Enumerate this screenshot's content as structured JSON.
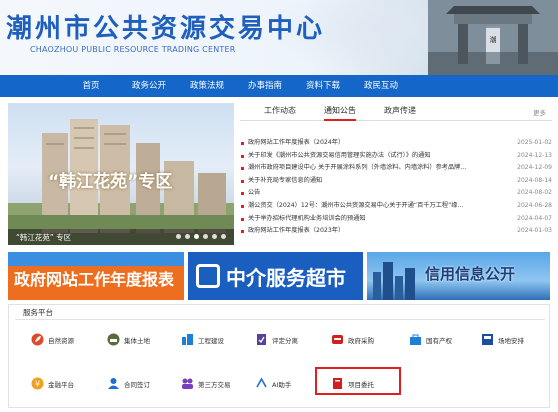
{
  "header": {
    "title": "潮州市公共资源交易中心",
    "subtitle": "CHAOZHOU PUBLIC RESOURCE TRADING CENTER"
  },
  "nav": [
    "首页",
    "政务公开",
    "政策法规",
    "办事指南",
    "资料下载",
    "政民互动"
  ],
  "banner": {
    "caption": "“韩江花苑”专区",
    "footer_text": "“韩江花苑” 专区"
  },
  "news": {
    "tabs": [
      "工作动态",
      "通知公告",
      "政声传递"
    ],
    "active_tab": 1,
    "more": "更多",
    "items": [
      {
        "title": "政府网站工作年度报表（2024年）",
        "date": "2025-01-02"
      },
      {
        "title": "关于印发《潮州市公共资源交易信用管理实施办法（试行）》的通知",
        "date": "2024-12-13"
      },
      {
        "title": "潮州市政府项目建设中心 关于开展涂料系列（外墙涂料、内墙涂料）参考品牌...",
        "date": "2024-12-09"
      },
      {
        "title": "关于补充局专家信息的通知",
        "date": "2024-08-14"
      },
      {
        "title": "公告",
        "date": "2024-08-02"
      },
      {
        "title": "潮公资交（2024）12号：潮州市公共资源交易中心关于开通“百千万工程”缘...",
        "date": "2024-06-28"
      },
      {
        "title": "关于举办招标代理机构业务培训会的预通知",
        "date": "2024-04-07"
      },
      {
        "title": "政府网站工作年度报表（2023年）",
        "date": "2024-01-03"
      }
    ]
  },
  "promos": {
    "report": "政府网站工作年度报表",
    "agency": "中介服务超市",
    "credit": "信用信息公开"
  },
  "services": {
    "header": "服务平台",
    "row1": [
      "自然资源",
      "集体土地",
      "工程建设",
      "评定分离",
      "政府采购",
      "国有产权",
      "场地安排"
    ],
    "row2": [
      "金融平台",
      "合同签订",
      "第三方交易",
      "AI助手",
      "项目委托"
    ]
  },
  "colors": {
    "brand_blue": "#1466c9",
    "accent_red": "#d22222",
    "promo_orange": "#ee6e1f"
  }
}
